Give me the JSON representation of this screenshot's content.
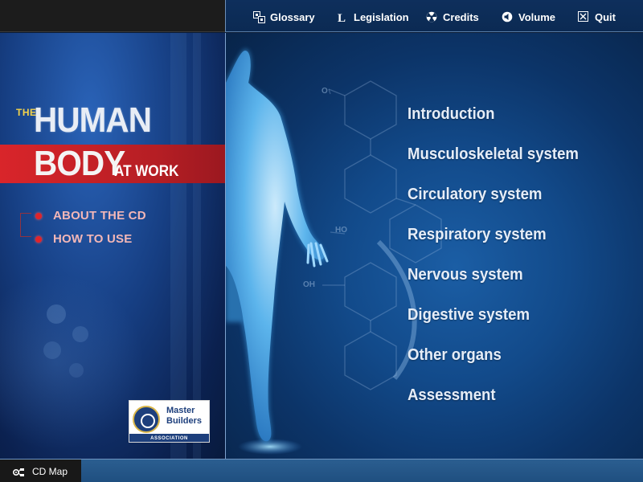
{
  "topnav": {
    "items": [
      {
        "label": "Glossary",
        "icon": "glossary-icon"
      },
      {
        "label": "Legislation",
        "icon": "legislation-icon"
      },
      {
        "label": "Credits",
        "icon": "credits-icon"
      },
      {
        "label": "Volume",
        "icon": "volume-icon"
      },
      {
        "label": "Quit",
        "icon": "quit-icon"
      }
    ]
  },
  "title": {
    "the": "THE",
    "human": "HUMAN",
    "body": "BODY",
    "at_work": "AT WORK"
  },
  "sidebar": {
    "links": [
      {
        "label": "ABOUT THE CD"
      },
      {
        "label": "HOW TO USE"
      }
    ]
  },
  "logo": {
    "name_line1": "Master",
    "name_line2": "Builders",
    "association": "ASSOCIATION"
  },
  "menu": {
    "items": [
      {
        "label": "Introduction"
      },
      {
        "label": "Musculoskeletal system"
      },
      {
        "label": "Circulatory system"
      },
      {
        "label": "Respiratory system"
      },
      {
        "label": "Nervous system"
      },
      {
        "label": "Digestive system"
      },
      {
        "label": "Other organs"
      },
      {
        "label": "Assessment"
      }
    ]
  },
  "molecule_labels": {
    "o": "O",
    "ho": "HO",
    "oh": "OH"
  },
  "footer": {
    "cdmap_label": "CD Map",
    "cdmap_icon": "cd-map-icon"
  },
  "colors": {
    "accent_red": "#d9252a",
    "navy": "#0b2a53",
    "menu_text": "#e6edf7",
    "title_yellow": "#f4d34a"
  }
}
